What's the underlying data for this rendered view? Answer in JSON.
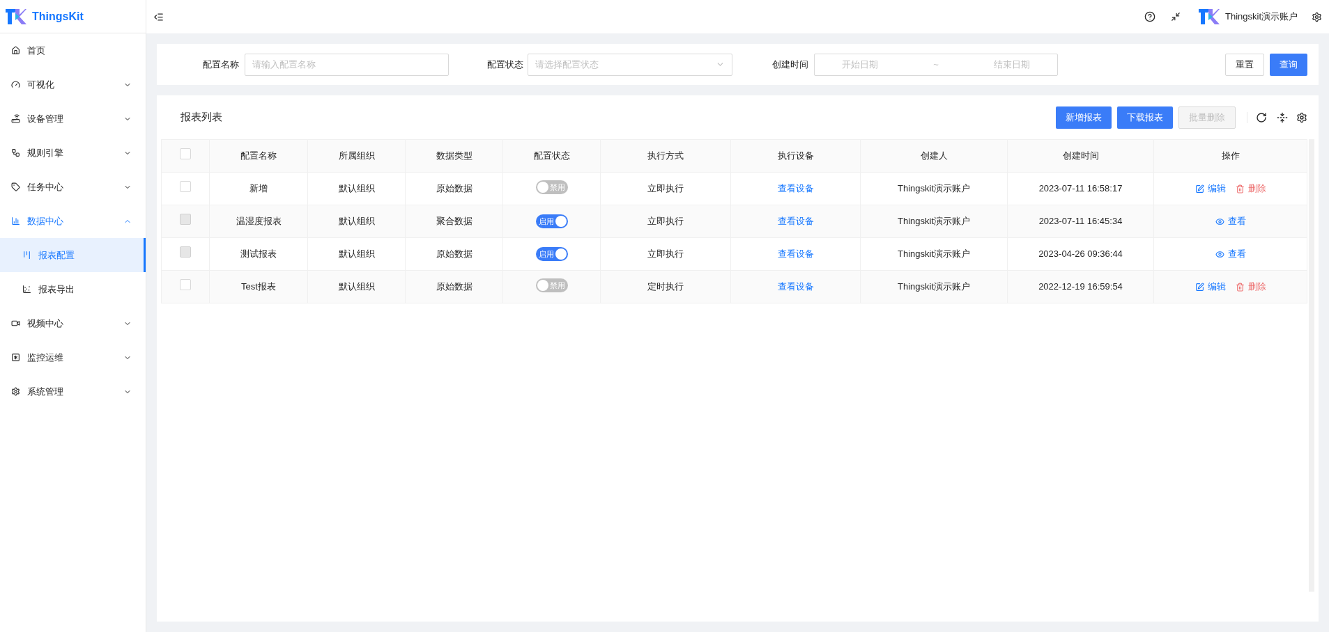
{
  "brand": {
    "name": "ThingsKit"
  },
  "sidebar": {
    "items": [
      {
        "label": "首页"
      },
      {
        "label": "可视化",
        "expanded": false
      },
      {
        "label": "设备管理",
        "expanded": false
      },
      {
        "label": "规则引擎",
        "expanded": false
      },
      {
        "label": "任务中心",
        "expanded": false
      },
      {
        "label": "数据中心",
        "expanded": true,
        "children": [
          {
            "label": "报表配置",
            "selected": true
          },
          {
            "label": "报表导出",
            "selected": false
          }
        ]
      },
      {
        "label": "视频中心",
        "expanded": false
      },
      {
        "label": "监控运维",
        "expanded": false
      },
      {
        "label": "系统管理",
        "expanded": false
      }
    ]
  },
  "header": {
    "user": "Thingskit演示账户"
  },
  "filters": {
    "name_label": "配置名称",
    "name_placeholder": "请输入配置名称",
    "status_label": "配置状态",
    "status_placeholder": "请选择配置状态",
    "time_label": "创建时间",
    "start_placeholder": "开始日期",
    "separator": "~",
    "end_placeholder": "结束日期",
    "reset": "重置",
    "search": "查询"
  },
  "table_card": {
    "title": "报表列表",
    "buttons": [
      {
        "label": "新增报表",
        "disabled": false
      },
      {
        "label": "下载报表",
        "disabled": false
      },
      {
        "label": "批量删除",
        "disabled": true
      }
    ]
  },
  "table": {
    "columns": [
      "配置名称",
      "所属组织",
      "数据类型",
      "配置状态",
      "执行方式",
      "执行设备",
      "创建人",
      "创建时间",
      "操作"
    ],
    "header_checked": false,
    "rows": [
      {
        "checked": false,
        "disabled": false,
        "name": "新增",
        "org": "默认组织",
        "data_type": "原始数据",
        "status": {
          "on": false,
          "label": "禁用"
        },
        "mode": "立即执行",
        "device": "查看设备",
        "creator": "Thingskit演示账户",
        "created": "2023-07-11 16:58:17",
        "actions": [
          {
            "kind": "edit",
            "label": "编辑"
          },
          {
            "kind": "delete",
            "label": "删除"
          }
        ]
      },
      {
        "checked": false,
        "disabled": true,
        "name": "温湿度报表",
        "org": "默认组织",
        "data_type": "聚合数据",
        "status": {
          "on": true,
          "label": "启用"
        },
        "mode": "立即执行",
        "device": "查看设备",
        "creator": "Thingskit演示账户",
        "created": "2023-07-11 16:45:34",
        "actions": [
          {
            "kind": "view",
            "label": "查看"
          }
        ]
      },
      {
        "checked": false,
        "disabled": true,
        "name": "测试报表",
        "org": "默认组织",
        "data_type": "原始数据",
        "status": {
          "on": true,
          "label": "启用"
        },
        "mode": "立即执行",
        "device": "查看设备",
        "creator": "Thingskit演示账户",
        "created": "2023-04-26 09:36:44",
        "actions": [
          {
            "kind": "view",
            "label": "查看"
          }
        ]
      },
      {
        "checked": false,
        "disabled": false,
        "name": "Test报表",
        "org": "默认组织",
        "data_type": "原始数据",
        "status": {
          "on": false,
          "label": "禁用"
        },
        "mode": "定时执行",
        "device": "查看设备",
        "creator": "Thingskit演示账户",
        "created": "2022-12-19 16:59:54",
        "actions": [
          {
            "kind": "edit",
            "label": "编辑"
          },
          {
            "kind": "delete",
            "label": "删除"
          }
        ]
      }
    ]
  }
}
